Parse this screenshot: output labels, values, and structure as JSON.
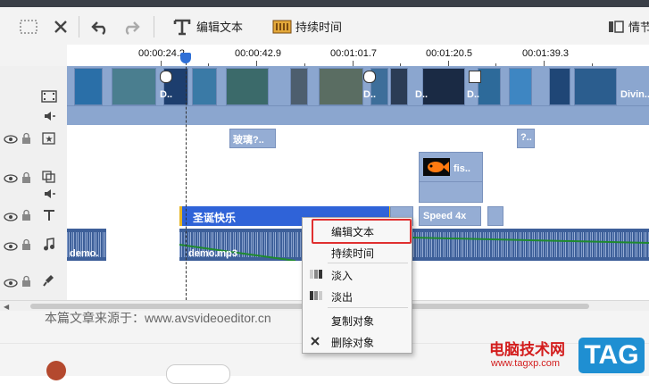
{
  "toolbar": {
    "edit_text_label": "编辑文本",
    "duration_label": "持续时间",
    "right_label": "情节"
  },
  "ruler": {
    "ticks": [
      "00:00:24.2",
      "00:00:42.9",
      "00:01:01.7",
      "00:01:20.5",
      "00:01:39.3"
    ]
  },
  "tracks": {
    "video_clip_labels": [
      "D..",
      "D..",
      "D..",
      "D..",
      "Divin.."
    ],
    "effects_clips": [
      "玻璃?..",
      "?.."
    ],
    "overlay_clip": "fis..",
    "text_clip": "圣诞快乐",
    "text_clip_speed": "Speed 4x",
    "audio_clip_left": "demo.",
    "audio_clip_main": "demo.mp3"
  },
  "context_menu": {
    "items": [
      "编辑文本",
      "持续时间",
      "淡入",
      "淡出",
      "复制对象",
      "删除对象"
    ]
  },
  "page": {
    "source_text": "本篇文章来源于：www.avsvideoeditor.cn",
    "brand": "电脑技术网",
    "brand_url": "www.tagxp.com",
    "tag": "TAG"
  },
  "colors": {
    "track_blue": "#8ba6cf",
    "audio_blue": "#3d5f99",
    "text_clip_blue": "#2f63d8",
    "highlight_red": "#e03030",
    "tag_blue": "#1f8fd2"
  }
}
